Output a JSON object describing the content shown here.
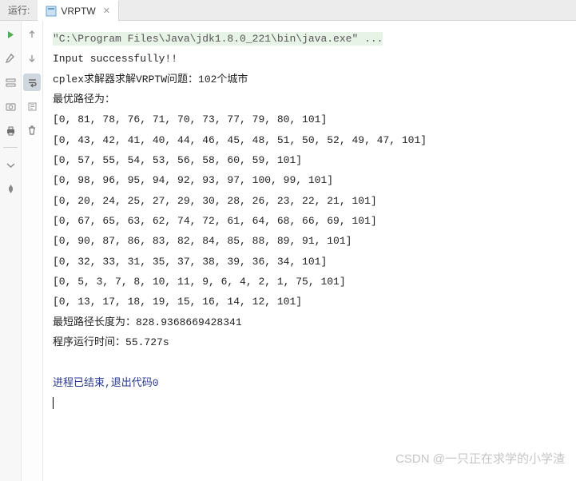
{
  "tabbar": {
    "run_label": "运行:",
    "tab_name": "VRPTW"
  },
  "console": {
    "command": "\"C:\\Program Files\\Java\\jdk1.8.0_221\\bin\\java.exe\" ...",
    "input_msg": "Input successfully!!",
    "solver_msg": "cplex求解器求解VRPTW问题：102个城市",
    "best_path_label": "最优路径为：",
    "routes": [
      "[0, 81, 78, 76, 71, 70, 73, 77, 79, 80, 101]",
      "[0, 43, 42, 41, 40, 44, 46, 45, 48, 51, 50, 52, 49, 47, 101]",
      "[0, 57, 55, 54, 53, 56, 58, 60, 59, 101]",
      "[0, 98, 96, 95, 94, 92, 93, 97, 100, 99, 101]",
      "[0, 20, 24, 25, 27, 29, 30, 28, 26, 23, 22, 21, 101]",
      "[0, 67, 65, 63, 62, 74, 72, 61, 64, 68, 66, 69, 101]",
      "[0, 90, 87, 86, 83, 82, 84, 85, 88, 89, 91, 101]",
      "[0, 32, 33, 31, 35, 37, 38, 39, 36, 34, 101]",
      "[0, 5, 3, 7, 8, 10, 11, 9, 6, 4, 2, 1, 75, 101]",
      "[0, 13, 17, 18, 19, 15, 16, 14, 12, 101]"
    ],
    "shortest_path_label": "最短路径长度为：",
    "shortest_path_value": "828.9368669428341",
    "runtime_label": "程序运行时间：",
    "runtime_value": "55.727s",
    "exit_msg": "进程已结束,退出代码0"
  },
  "watermark": "CSDN @一只正在求学的小学渣"
}
